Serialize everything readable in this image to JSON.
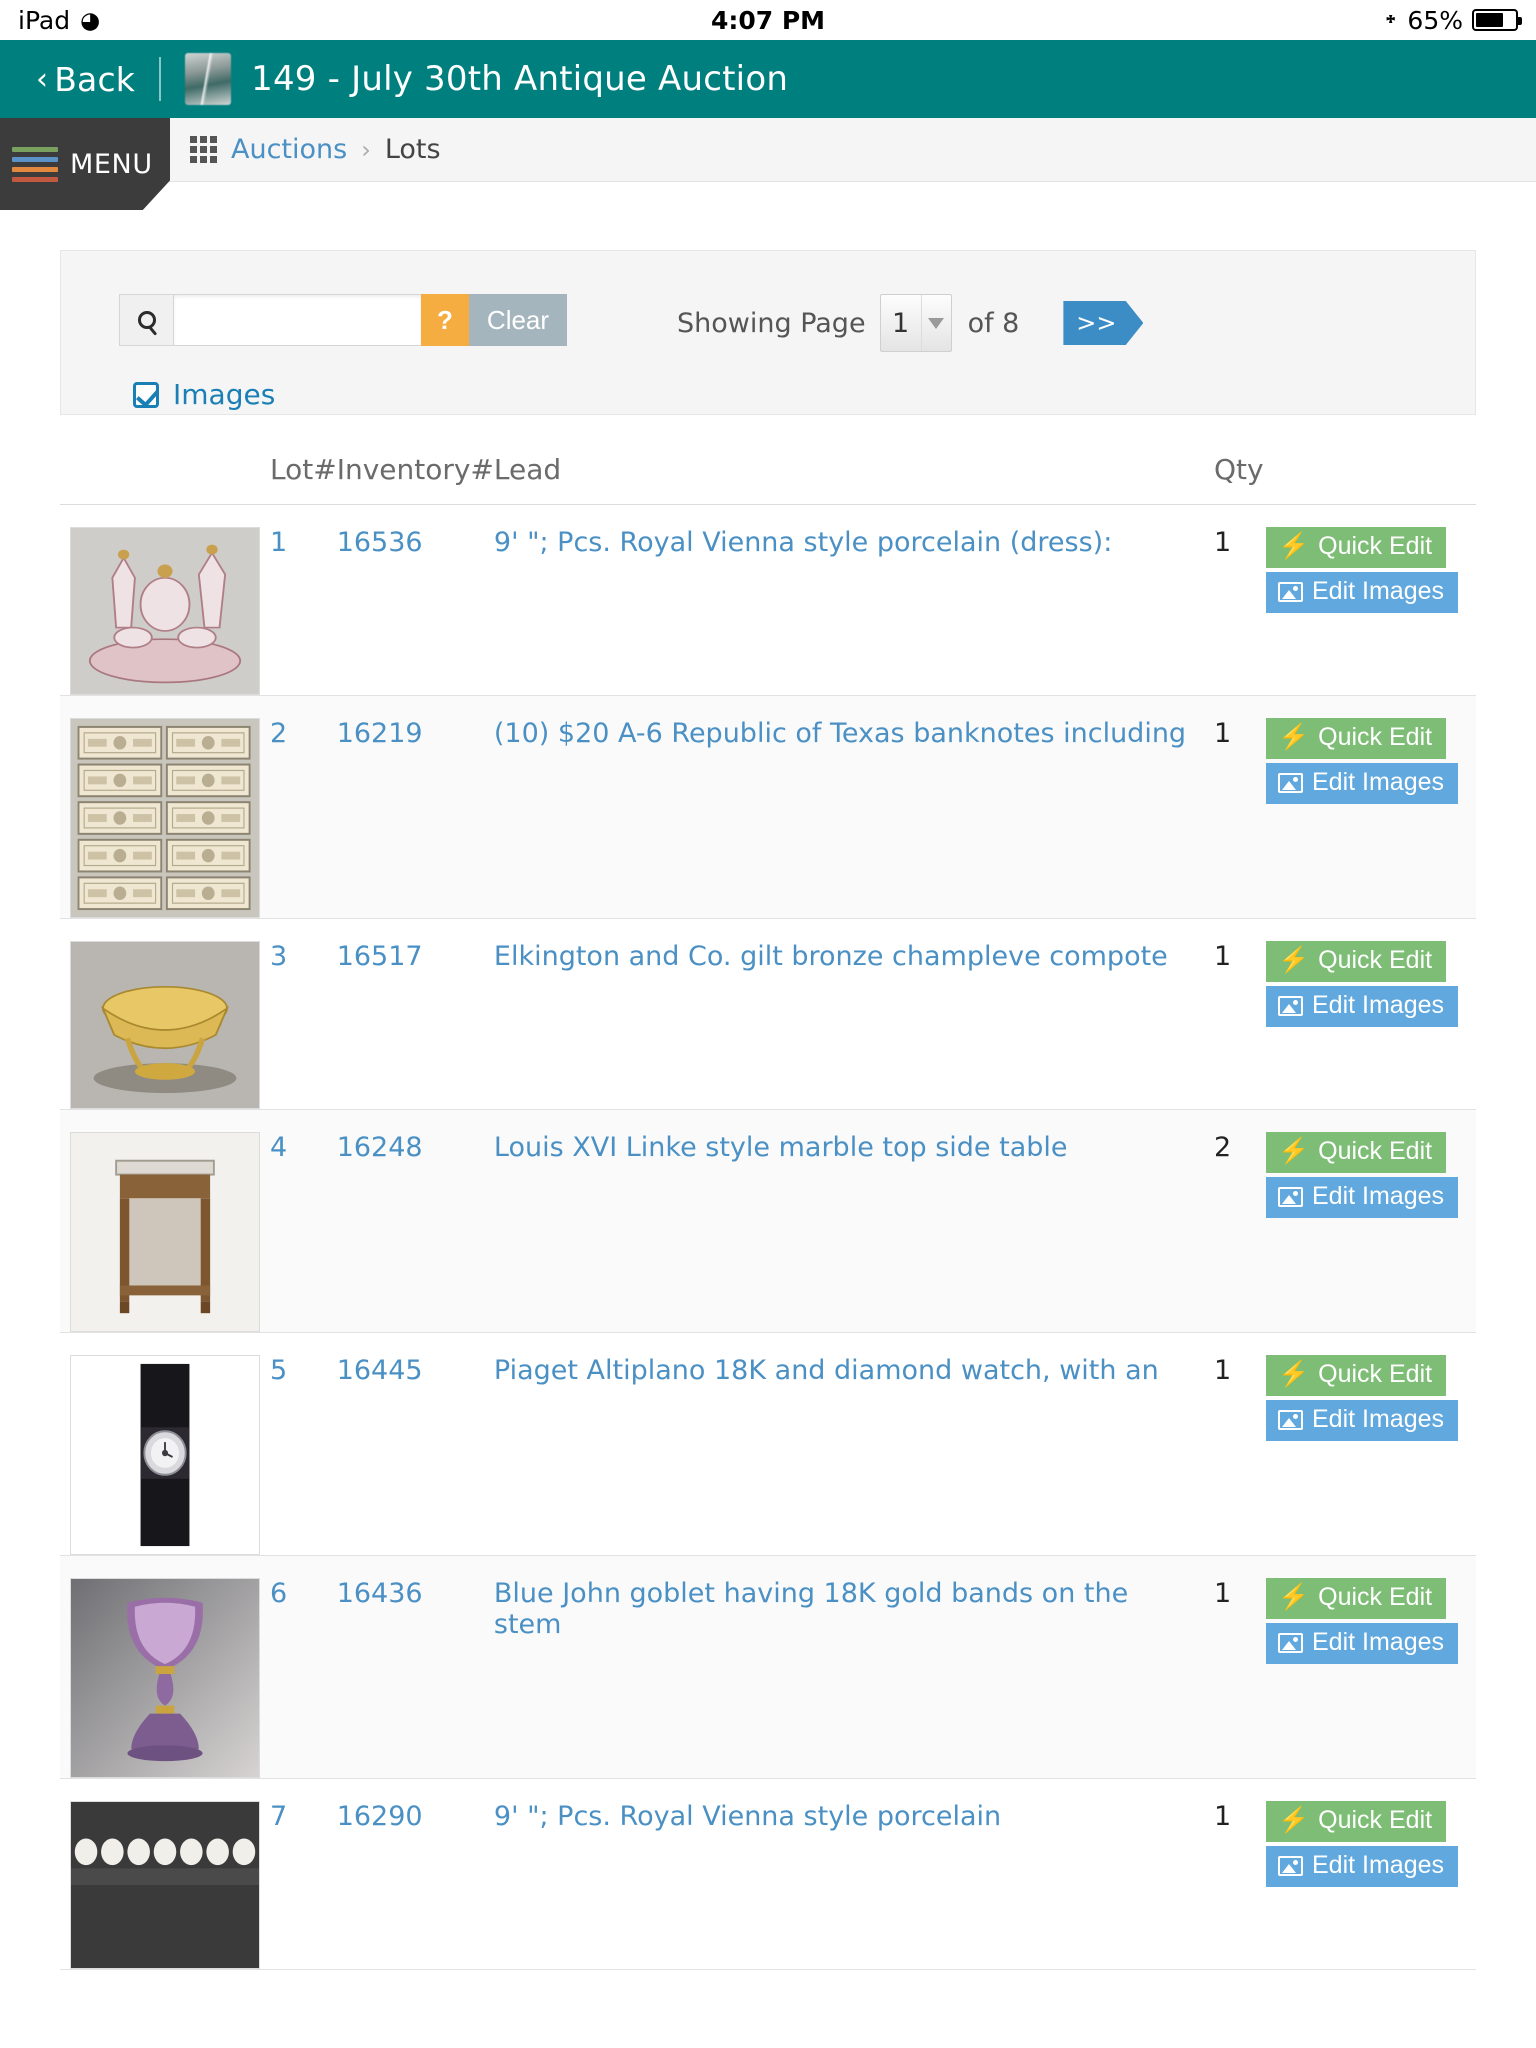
{
  "status_bar": {
    "device": "iPad",
    "wifi_icon": "wifi-icon",
    "time": "4:07 PM",
    "bluetooth_icon": "bluetooth-icon",
    "battery_text": "65%"
  },
  "title_bar": {
    "back_label": "Back",
    "logo_icon": "auction-logo-icon",
    "title": "149 - July 30th Antique Auction"
  },
  "menu_bar": {
    "menu_label": "MENU",
    "grid_icon": "grid-apps-icon",
    "breadcrumb": {
      "parent": "Auctions",
      "separator": "›",
      "current": "Lots"
    }
  },
  "toolbar": {
    "search_icon": "search-icon",
    "search_value": "",
    "search_placeholder": "",
    "help_label": "?",
    "clear_label": "Clear",
    "showing_page_label": "Showing Page",
    "current_page": "1",
    "of_label": "of 8",
    "next_label": ">>",
    "images_checkbox_label": "Images",
    "images_checked": true,
    "accent_orange": "#f5ad42",
    "accent_grayblue": "#a5b5bd",
    "accent_blue": "#3c8dc5"
  },
  "table": {
    "columns": [
      "Lot#",
      "Inventory#",
      "Lead",
      "Qty"
    ],
    "actions": {
      "quick_edit_label": "Quick Edit",
      "quick_edit_icon": "bolt-icon",
      "quick_edit_color": "#7dbd75",
      "edit_images_label": "Edit Images",
      "edit_images_icon": "image-icon",
      "edit_images_color": "#60a8dd"
    },
    "rows": [
      {
        "lot": "1",
        "inventory": "16536",
        "lead": "9' \"; Pcs. Royal Vienna style porcelain (dress):",
        "qty": "1",
        "thumb": "royal-vienna-porcelain-dresser-set"
      },
      {
        "lot": "2",
        "inventory": "16219",
        "lead": "(10) $20 A-6 Republic of Texas banknotes including",
        "qty": "1",
        "thumb": "texas-banknotes-grid"
      },
      {
        "lot": "3",
        "inventory": "16517",
        "lead": "Elkington and Co. gilt bronze champleve compote",
        "qty": "1",
        "thumb": "gilt-bronze-compote"
      },
      {
        "lot": "4",
        "inventory": "16248",
        "lead": "Louis XVI Linke style marble top side table",
        "qty": "2",
        "thumb": "marble-top-side-table"
      },
      {
        "lot": "5",
        "inventory": "16445",
        "lead": "Piaget Altiplano 18K and diamond watch, with an",
        "qty": "1",
        "thumb": "piaget-wristwatch"
      },
      {
        "lot": "6",
        "inventory": "16436",
        "lead": "Blue John goblet having 18K gold bands on the stem",
        "qty": "1",
        "thumb": "blue-john-goblet"
      },
      {
        "lot": "7",
        "inventory": "16290",
        "lead": "9' \"; Pcs. Royal Vienna style porcelain",
        "qty": "1",
        "thumb": "porcelain-cups-row"
      }
    ]
  }
}
